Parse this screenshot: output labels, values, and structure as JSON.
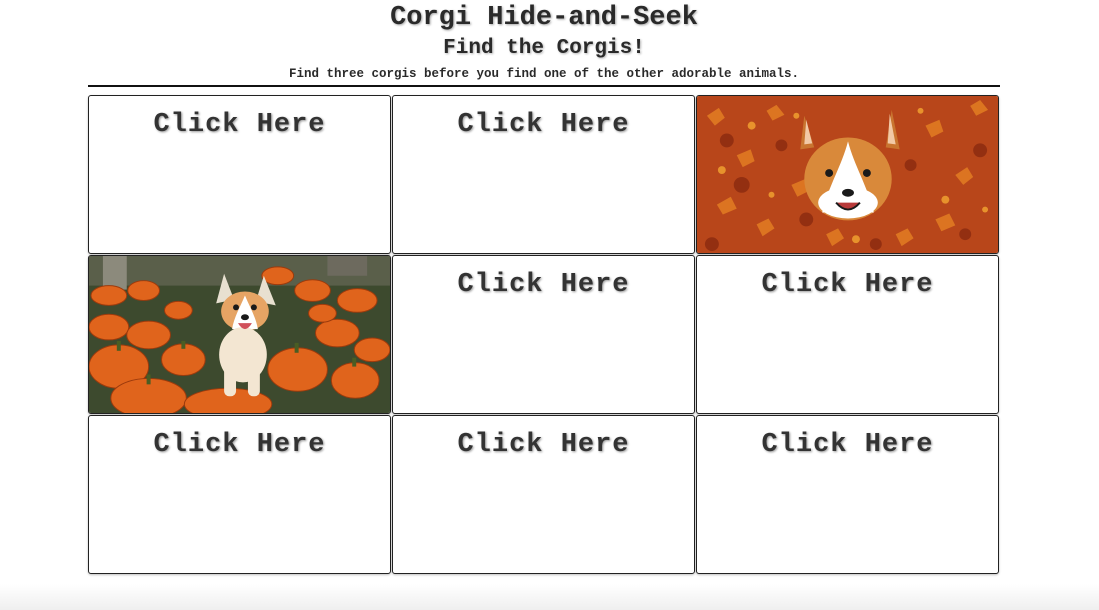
{
  "header": {
    "title": "Corgi Hide-and-Seek",
    "subtitle": "Find the Corgis!",
    "instructions": "Find three corgis before you find one of the other adorable animals."
  },
  "grid": {
    "cells": [
      {
        "state": "hidden",
        "label": "Click Here"
      },
      {
        "state": "hidden",
        "label": "Click Here"
      },
      {
        "state": "revealed",
        "image": "corgi-in-autumn-leaves-photo"
      },
      {
        "state": "revealed",
        "image": "corgi-on-pumpkins-photo"
      },
      {
        "state": "hidden",
        "label": "Click Here"
      },
      {
        "state": "hidden",
        "label": "Click Here"
      },
      {
        "state": "hidden",
        "label": "Click Here"
      },
      {
        "state": "hidden",
        "label": "Click Here"
      },
      {
        "state": "hidden",
        "label": "Click Here"
      }
    ]
  },
  "colors": {
    "text": "#2a2a2a",
    "border": "#222222",
    "leaves": "#c8501a",
    "pumpkin": "#e0641c",
    "corgi_fur": "#d9893a"
  }
}
